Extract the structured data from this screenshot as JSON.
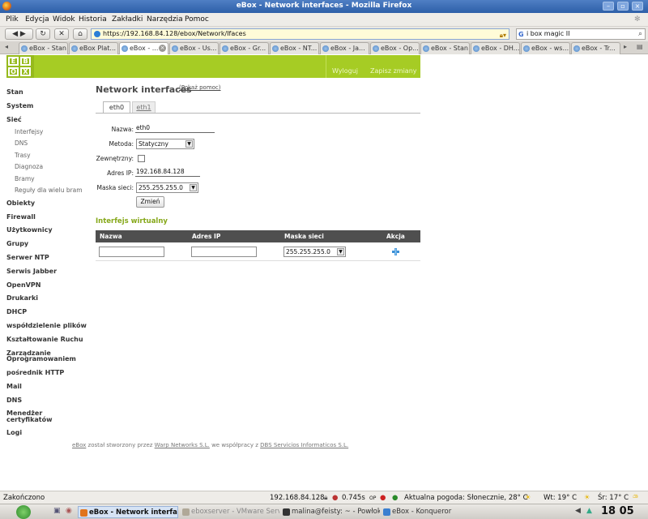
{
  "window": {
    "title": "eBox - Network interfaces - Mozilla Firefox"
  },
  "menubar": [
    "Plik",
    "Edycja",
    "Widok",
    "Historia",
    "Zakładki",
    "Narzędzia",
    "Pomoc"
  ],
  "navbar": {
    "url": "https://192.168.84.128/ebox/Network/Ifaces",
    "search_value": "i box magic II",
    "search_engine": "G"
  },
  "tabs": [
    "eBox - Stan",
    "eBox Plat...",
    "eBox - ...",
    "eBox - Us...",
    "eBox - Gr...",
    "eBox - NT...",
    "eBox - Ja...",
    "eBox - Op...",
    "eBox - Stan",
    "eBox - DH...",
    "eBox - ws...",
    "eBox - Tr..."
  ],
  "header": {
    "logo": [
      "E",
      "B",
      "O",
      "X"
    ],
    "logout": "Wyloguj",
    "save": "Zapisz zmiany",
    "accent_color": "#a6cc24"
  },
  "sidebar": {
    "items": [
      "Stan",
      "System",
      "Sieć"
    ],
    "subitems": [
      "Interfejsy",
      "DNS",
      "Trasy",
      "Diagnoza",
      "Bramy",
      "Reguły dla wielu bram"
    ],
    "items2": [
      "Obiekty",
      "Firewall",
      "Użytkownicy",
      "Grupy",
      "Serwer NTP",
      "Serwis Jabber",
      "OpenVPN",
      "Drukarki",
      "DHCP",
      "współdzielenie plików",
      "Kształtowanie Ruchu",
      "Zarządzanie",
      "Oprogramowaniem",
      "pośrednik HTTP",
      "Mail",
      "DNS",
      "Menedżer",
      "certyfikatów",
      "Logi"
    ]
  },
  "page": {
    "title": "Network interfaces",
    "help": "(Pokaż pomoc)",
    "tabs": [
      "eth0",
      "eth1"
    ]
  },
  "form": {
    "name_label": "Nazwa:",
    "name_value": "eth0",
    "method_label": "Metoda:",
    "method_value": "Statyczny",
    "external_label": "Zewnętrzny:",
    "ip_label": "Adres IP:",
    "ip_value": "192.168.84.128",
    "mask_label": "Maska sieci:",
    "mask_value": "255.255.255.0",
    "change_button": "Zmień"
  },
  "virtual": {
    "title": "Interfejs wirtualny",
    "columns": [
      "Nazwa",
      "Adres IP",
      "Maska sieci",
      "Akcja"
    ],
    "mask_value": "255.255.255.0"
  },
  "footer": {
    "p1": "eBox",
    "p2": " został stworzony przez ",
    "p3": "Warp Networks S.L.",
    "p4": " we współpracy z ",
    "p5": "DBS Servicios Informaticos S.L."
  },
  "statusbar": {
    "left": "Zakończono",
    "host": "192.168.84.128",
    "time": "0.745s",
    "op": "OP",
    "weather": "Aktualna pogoda: Słonecznie, 28° C",
    "wt": "Wt: 19° C",
    "sr": "Śr: 17° C"
  },
  "taskbar": {
    "items": [
      "eBox - Network interfaces",
      "eboxserver - VMware Server",
      "malina@feisty: ~ - Powłoka",
      "eBox - Konqueror"
    ],
    "clock": "18 05"
  }
}
